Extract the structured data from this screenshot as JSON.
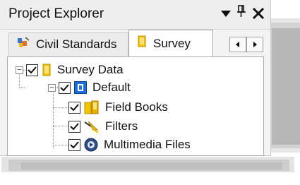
{
  "panel": {
    "title": "Project Explorer",
    "title_buttons": [
      {
        "name": "dropdown-arrow-icon",
        "glyph": "▼"
      },
      {
        "name": "pin-icon",
        "glyph": "ᵖ"
      },
      {
        "name": "close-icon",
        "glyph": "✕"
      }
    ]
  },
  "tabs": [
    {
      "label": "Civil Standards",
      "icon": "civil-standards-icon",
      "active": false
    },
    {
      "label": "Survey",
      "icon": "survey-folder-icon",
      "active": true
    }
  ],
  "tree": {
    "items": [
      {
        "label": "Survey Data",
        "icon": "folder-icon",
        "checked": true,
        "expander": "minus"
      },
      {
        "label": "Default",
        "icon": "database-icon",
        "checked": true,
        "expander": "minus"
      },
      {
        "label": "Field Books",
        "icon": "field-books-icon",
        "checked": true
      },
      {
        "label": "Filters",
        "icon": "filter-icon",
        "checked": true
      },
      {
        "label": "Multimedia Files",
        "icon": "multimedia-icon",
        "checked": true
      }
    ]
  },
  "colors": {
    "accent_blue": "#1e6fd9",
    "folder_yellow": "#f2c300"
  }
}
